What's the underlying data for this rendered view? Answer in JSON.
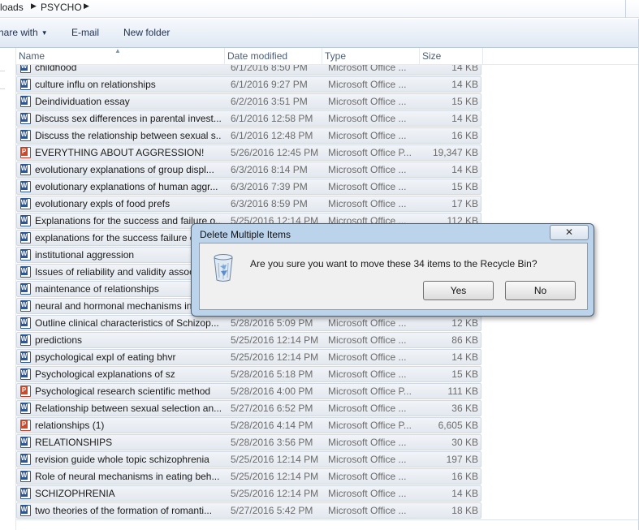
{
  "address_bar": {
    "crumbs": [
      "loads",
      "PSYCHO"
    ]
  },
  "toolbar": {
    "share_label": "hare with",
    "email_label": "E-mail",
    "new_folder_label": "New folder"
  },
  "columns": {
    "name": "Name",
    "date": "Date modified",
    "type": "Type",
    "size": "Size"
  },
  "files": [
    {
      "icon": "word-doc-icon",
      "name": "childhood",
      "date": "6/1/2016 8:50 PM",
      "type": "Microsoft Office ...",
      "size": "14 KB"
    },
    {
      "icon": "word-doc-icon",
      "name": "culture influ on relationships",
      "date": "6/1/2016 9:27 PM",
      "type": "Microsoft Office ...",
      "size": "14 KB"
    },
    {
      "icon": "word-doc-icon",
      "name": "Deindividuation essay",
      "date": "6/2/2016 3:51 PM",
      "type": "Microsoft Office ...",
      "size": "15 KB"
    },
    {
      "icon": "word-doc-icon",
      "name": "Discuss sex differences in parental invest...",
      "date": "6/1/2016 12:58 PM",
      "type": "Microsoft Office ...",
      "size": "14 KB"
    },
    {
      "icon": "word-doc-icon",
      "name": "Discuss the relationship between sexual s...",
      "date": "6/1/2016 12:48 PM",
      "type": "Microsoft Office ...",
      "size": "16 KB"
    },
    {
      "icon": "powerpoint-icon",
      "name": "EVERYTHING ABOUT AGGRESSION!",
      "date": "5/26/2016 12:45 PM",
      "type": "Microsoft Office P...",
      "size": "19,347 KB"
    },
    {
      "icon": "word-doc-icon",
      "name": "evolutionary explanations of group displ...",
      "date": "6/3/2016 8:14 PM",
      "type": "Microsoft Office ...",
      "size": "14 KB"
    },
    {
      "icon": "word-doc-icon",
      "name": "evolutionary explanations of human aggr...",
      "date": "6/3/2016 7:39 PM",
      "type": "Microsoft Office ...",
      "size": "15 KB"
    },
    {
      "icon": "word-doc-icon",
      "name": "evolutionary expls of food prefs",
      "date": "6/3/2016 8:59 PM",
      "type": "Microsoft Office ...",
      "size": "17 KB"
    },
    {
      "icon": "word-doc-icon",
      "name": "Explanations for the success and failure o...",
      "date": "5/25/2016 12:14 PM",
      "type": "Microsoft Office ...",
      "size": "112 KB"
    },
    {
      "icon": "word-doc-icon",
      "name": "explanations for the success failure o...",
      "date": "",
      "type": "",
      "size": ""
    },
    {
      "icon": "word-doc-icon",
      "name": "institutional aggression",
      "date": "",
      "type": "",
      "size": ""
    },
    {
      "icon": "word-doc-icon",
      "name": "Issues of reliability and validity assoc...",
      "date": "",
      "type": "",
      "size": ""
    },
    {
      "icon": "word-doc-icon",
      "name": "maintenance of relationships",
      "date": "",
      "type": "",
      "size": ""
    },
    {
      "icon": "word-doc-icon",
      "name": "neural and hormonal mechanisms in...",
      "date": "",
      "type": "",
      "size": ""
    },
    {
      "icon": "word-doc-icon",
      "name": "Outline clinical characteristics of Schizop...",
      "date": "5/28/2016 5:09 PM",
      "type": "Microsoft Office ...",
      "size": "12 KB"
    },
    {
      "icon": "word-doc-icon",
      "name": "predictions",
      "date": "5/25/2016 12:14 PM",
      "type": "Microsoft Office ...",
      "size": "86 KB"
    },
    {
      "icon": "word-doc-icon",
      "name": "psychological expl of eating bhvr",
      "date": "5/25/2016 12:14 PM",
      "type": "Microsoft Office ...",
      "size": "14 KB"
    },
    {
      "icon": "word-doc-icon",
      "name": "Psychological explanations of sz",
      "date": "5/28/2016 5:18 PM",
      "type": "Microsoft Office ...",
      "size": "15 KB"
    },
    {
      "icon": "powerpoint-icon",
      "name": "Psychological research  scientific method",
      "date": "5/28/2016 4:00 PM",
      "type": "Microsoft Office P...",
      "size": "111 KB"
    },
    {
      "icon": "word-doc-icon",
      "name": "Relationship between sexual selection an...",
      "date": "5/27/2016 6:52 PM",
      "type": "Microsoft Office ...",
      "size": "36 KB"
    },
    {
      "icon": "powerpoint-icon",
      "name": "relationships (1)",
      "date": "5/28/2016 4:14 PM",
      "type": "Microsoft Office P...",
      "size": "6,605 KB"
    },
    {
      "icon": "word-doc-icon",
      "name": "RELATIONSHIPS",
      "date": "5/28/2016 3:56 PM",
      "type": "Microsoft Office ...",
      "size": "30 KB"
    },
    {
      "icon": "word-doc-icon",
      "name": "revision guide whole topic schizophrenia",
      "date": "5/25/2016 12:14 PM",
      "type": "Microsoft Office ...",
      "size": "197 KB"
    },
    {
      "icon": "word-doc-icon",
      "name": "Role of neural mechanisms in eating beh...",
      "date": "5/25/2016 12:14 PM",
      "type": "Microsoft Office ...",
      "size": "16 KB"
    },
    {
      "icon": "word-doc-icon",
      "name": "SCHIZOPHRENIA",
      "date": "5/25/2016 12:14 PM",
      "type": "Microsoft Office ...",
      "size": "14 KB"
    },
    {
      "icon": "word-doc-icon",
      "name": "two theories of the formation of romanti...",
      "date": "5/27/2016 5:42 PM",
      "type": "Microsoft Office ...",
      "size": "18 KB"
    }
  ],
  "dialog": {
    "title": "Delete Multiple Items",
    "close_label": "✕",
    "message": "Are you sure you want to move these 34 items to the Recycle Bin?",
    "yes_label": "Yes",
    "no_label": "No",
    "icon": "recycle-bin-icon"
  }
}
